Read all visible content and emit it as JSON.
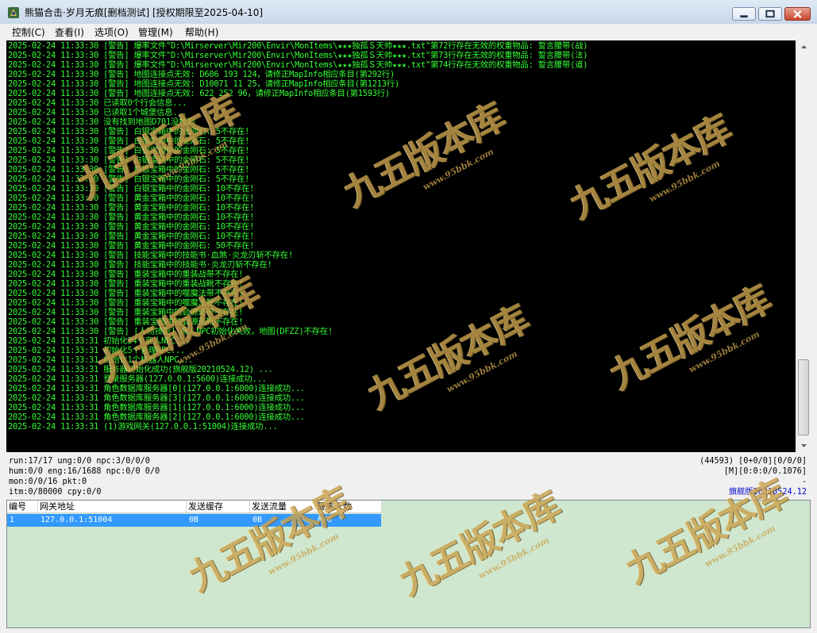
{
  "window": {
    "title": "熊猫合击·岁月无痕[删档测试] [授权期限至2025-04-10]"
  },
  "menu": [
    {
      "label": "控制(C)"
    },
    {
      "label": "查看(I)"
    },
    {
      "label": "选项(O)"
    },
    {
      "label": "管理(M)"
    },
    {
      "label": "帮助(H)"
    }
  ],
  "console": {
    "text_color": "#33ff33",
    "lines": [
      "2025-02-24 11:33:30 [警告] 爆率文件\"D:\\Mirserver\\Mir200\\Envir\\MonItems\\★★★独孤Ｓ天帅★★★.txt\"第72行存在无效的权重物品: 誓言腰带(战)",
      "2025-02-24 11:33:30 [警告] 爆率文件\"D:\\Mirserver\\Mir200\\Envir\\MonItems\\★★★独孤Ｓ天帅★★★.txt\"第73行存在无效的权重物品: 誓言腰带(法)",
      "2025-02-24 11:33:30 [警告] 爆率文件\"D:\\Mirserver\\Mir200\\Envir\\MonItems\\★★★独孤Ｓ天帅★★★.txt\"第74行存在无效的权重物品: 誓言腰带(道)",
      "2025-02-24 11:33:30 [警告] 地图连接点无效: D606 193 124，请修正MapInfo相应条目(第292行)",
      "2025-02-24 11:33:30 [警告] 地图连接点无效: D10071 11 25，请修正MapInfo相应条目(第1213行)",
      "2025-02-24 11:33:30 [警告] 地图连接点无效: 622 252 96，请修正MapInfo相应条目(第1593行)",
      "2025-02-24 11:33:30 已读取0个行会信息...",
      "2025-02-24 11:33:30 已读取1个城堡信息...",
      "2025-02-24 11:33:30 没有找到地图D701没找到",
      "2025-02-24 11:33:30 [警告] 白银宝箱中的金刚石: 5不存在!",
      "2025-02-24 11:33:30 [警告] 白银宝箱中的金刚石: 5不存在!",
      "2025-02-24 11:33:30 [警告] 白银宝箱中的金刚石: 5不存在!",
      "2025-02-24 11:33:30 [警告] 白银宝箱中的金刚石: 5不存在!",
      "2025-02-24 11:33:30 [警告] 白银宝箱中的金刚石: 5不存在!",
      "2025-02-24 11:33:30 [警告] 白银宝箱中的金刚石: 5不存在!",
      "2025-02-24 11:33:30 [警告] 白银宝箱中的金刚石: 10不存在!",
      "2025-02-24 11:33:30 [警告] 黄金宝箱中的金刚石: 10不存在!",
      "2025-02-24 11:33:30 [警告] 黄金宝箱中的金刚石: 10不存在!",
      "2025-02-24 11:33:30 [警告] 黄金宝箱中的金刚石: 10不存在!",
      "2025-02-24 11:33:30 [警告] 黄金宝箱中的金刚石: 10不存在!",
      "2025-02-24 11:33:30 [警告] 黄金宝箱中的金刚石: 10不存在!",
      "2025-02-24 11:33:30 [警告] 黄金宝箱中的金刚石: 50不存在!",
      "2025-02-24 11:33:30 [警告] 技能宝箱中的技能书·血煞·炎龙刃斩不存在!",
      "2025-02-24 11:33:30 [警告] 技能宝箱中的技能书·炎龙刃斩不存在!",
      "2025-02-24 11:33:30 [警告] 重装宝箱中的重装战带不存在!",
      "2025-02-24 11:33:30 [警告] 重装宝箱中的重装战靴不存在!",
      "2025-02-24 11:33:30 [警告] 重装宝箱中的噬魔法带不存在!",
      "2025-02-24 11:33:30 [警告] 重装宝箱中的噬魔法靴不存在!",
      "2025-02-24 11:33:30 [警告] 重装宝箱中的启源道带不存在!",
      "2025-02-24 11:33:30 [警告] 重装宝箱中的启源道靴不存在!",
      "2025-02-24 11:33:30 [警告] [人物技能] 商人NPC初始化失败，地图(DFZZ)不存在!",
      "2025-02-24 11:33:31 初始化34个商人NPC...",
      "2025-02-24 11:33:31 初始化5个管理NPC...",
      "2025-02-24 11:33:31 初始化1个机器人NPC...",
      "2025-02-24 11:33:31 服务器初始化成功(旗舰版20210524.12) ...",
      "2025-02-24 11:33:31 登录服务器(127.0.0.1:5600)连接成功...",
      "2025-02-24 11:33:31 角色数据库服务器[0](127.0.0.1:6000)连接成功...",
      "2025-02-24 11:33:31 角色数据库服务器[3](127.0.0.1:6000)连接成功...",
      "2025-02-24 11:33:31 角色数据库服务器[1](127.0.0.1:6000)连接成功...",
      "2025-02-24 11:33:31 角色数据库服务器[2](127.0.0.1:6000)连接成功...",
      "2025-02-24 11:33:31 (1)游戏网关(127.0.0.1:51004)连接成功..."
    ]
  },
  "status": {
    "left": [
      "run:17/17 ung:0/0 npc:3/0/0/0",
      "hum:0/0 eng:16/1688 npc:0/0 0/0",
      "mon:0/0/16 pkt:0",
      "itm:0/80000 cpy:0/0"
    ],
    "right": [
      "(44593) [0+0/0][0/0/0]",
      "[M][0:0:0/0.1076]",
      "-",
      "旗舰版20210524.12"
    ],
    "version_color": "#0000cc"
  },
  "gateway_table": {
    "columns": [
      "编号",
      "网关地址",
      "发送缓存",
      "发送流量",
      "最高人数"
    ],
    "rows": [
      [
        "1",
        "127.0.0.1:51004",
        "0B",
        "0B",
        "0/0"
      ]
    ],
    "selected_color": "#3399ff"
  },
  "watermark": {
    "text": "九五版本库",
    "url": "www.95bbk.com"
  }
}
